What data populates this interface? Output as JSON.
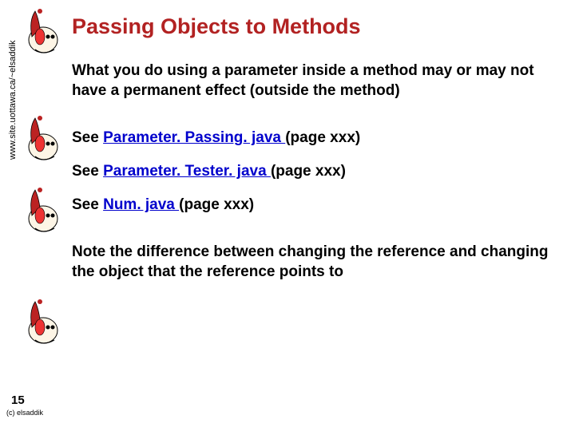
{
  "sidebar": {
    "url": "www.site.uottawa.ca/~elsaddik"
  },
  "title": "Passing Objects to Methods",
  "para1": "What you do using a parameter inside a method may or may not have a permanent effect (outside the method)",
  "see": [
    {
      "prefix": "See ",
      "link": "Parameter. Passing. java ",
      "suffix": "(page xxx)"
    },
    {
      "prefix": "See ",
      "link": "Parameter. Tester. java ",
      "suffix": "(page xxx)"
    },
    {
      "prefix": "See ",
      "link": "Num. java ",
      "suffix": "(page xxx)"
    }
  ],
  "note": "Note the difference between changing the reference and changing the object that the reference points to",
  "footer": {
    "slide_number": "15",
    "credit": "(c) elsaddik"
  }
}
